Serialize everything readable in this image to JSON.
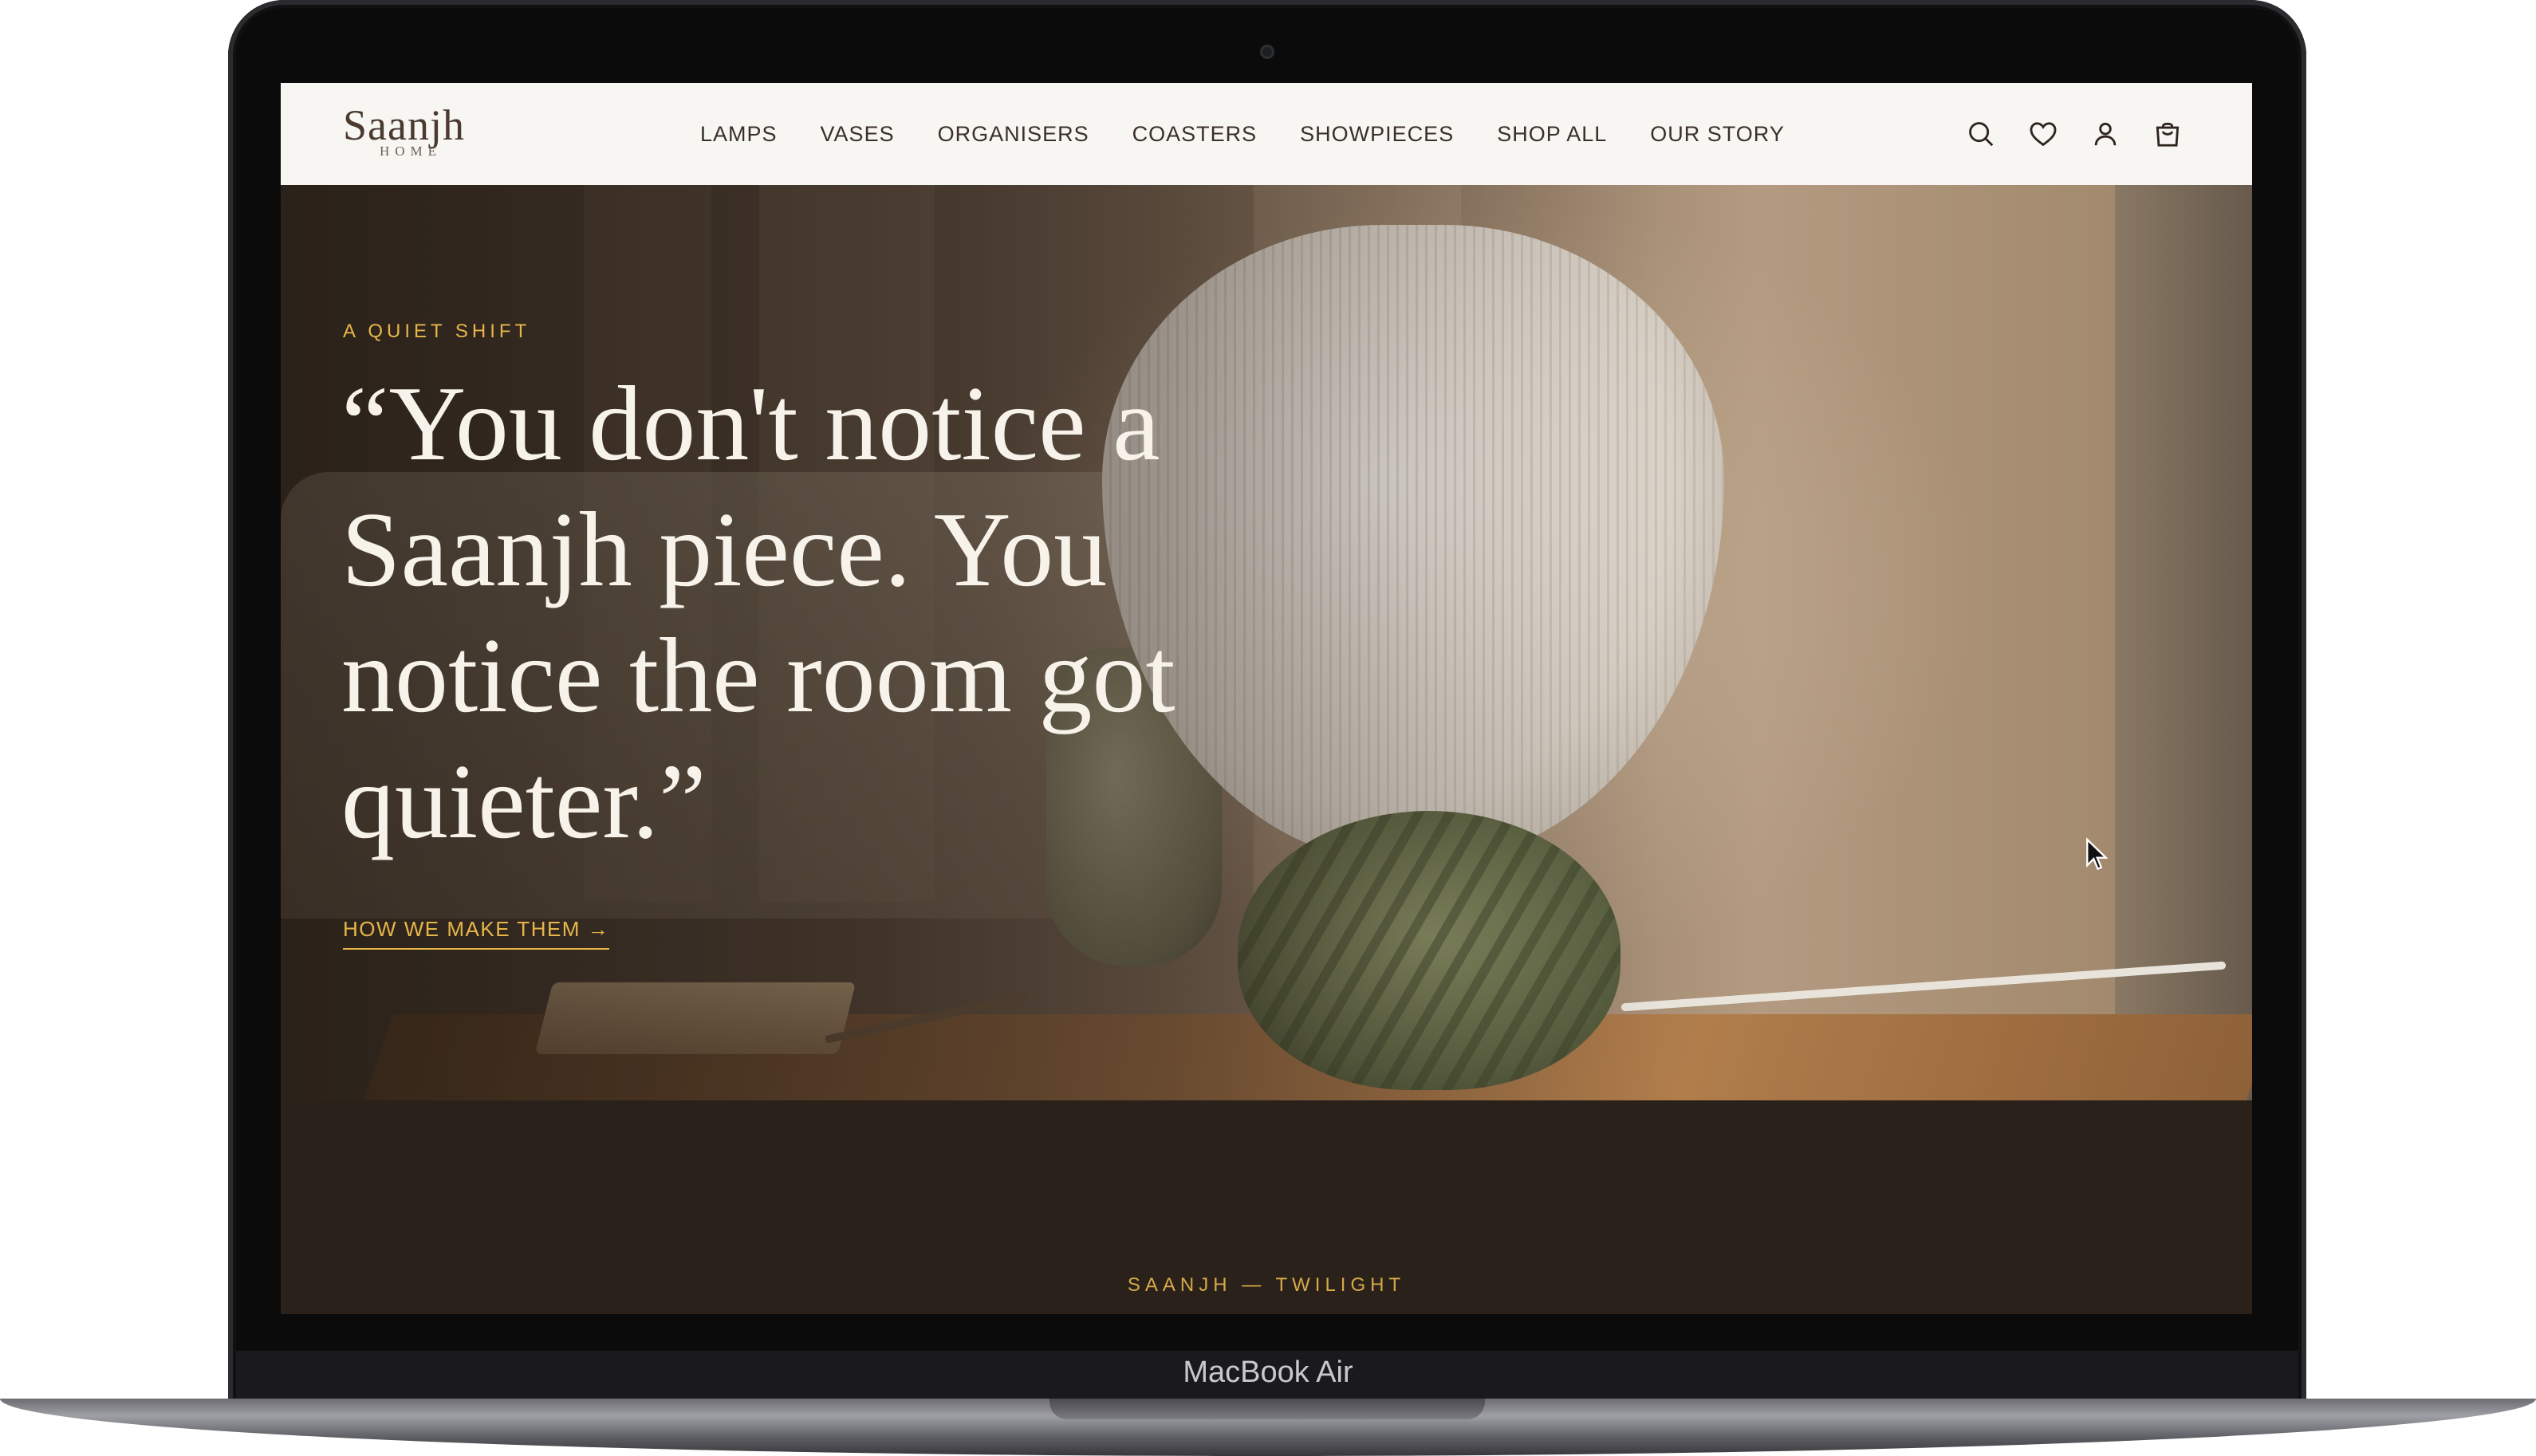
{
  "device": {
    "model_label": "MacBook Air"
  },
  "brand": {
    "name": "Saanjh",
    "sub": "HOME"
  },
  "nav": {
    "links": [
      "LAMPS",
      "VASES",
      "ORGANISERS",
      "COASTERS",
      "SHOWPIECES",
      "SHOP ALL",
      "OUR STORY"
    ],
    "icons": [
      "search-icon",
      "heart-icon",
      "user-icon",
      "cart-icon"
    ]
  },
  "hero": {
    "eyebrow": "A QUIET SHIFT",
    "headline": "“You don't notice a Saanjh piece. You notice the room got quieter.”",
    "cta": "HOW WE MAKE THEM →"
  },
  "section": {
    "tag": "SAANJH — TWILIGHT"
  },
  "colors": {
    "nav_bg": "#f8f6f2",
    "accent_gold": "#e6b64a",
    "dark_bg": "#2b211b",
    "headline_text": "#f7f2ea"
  }
}
